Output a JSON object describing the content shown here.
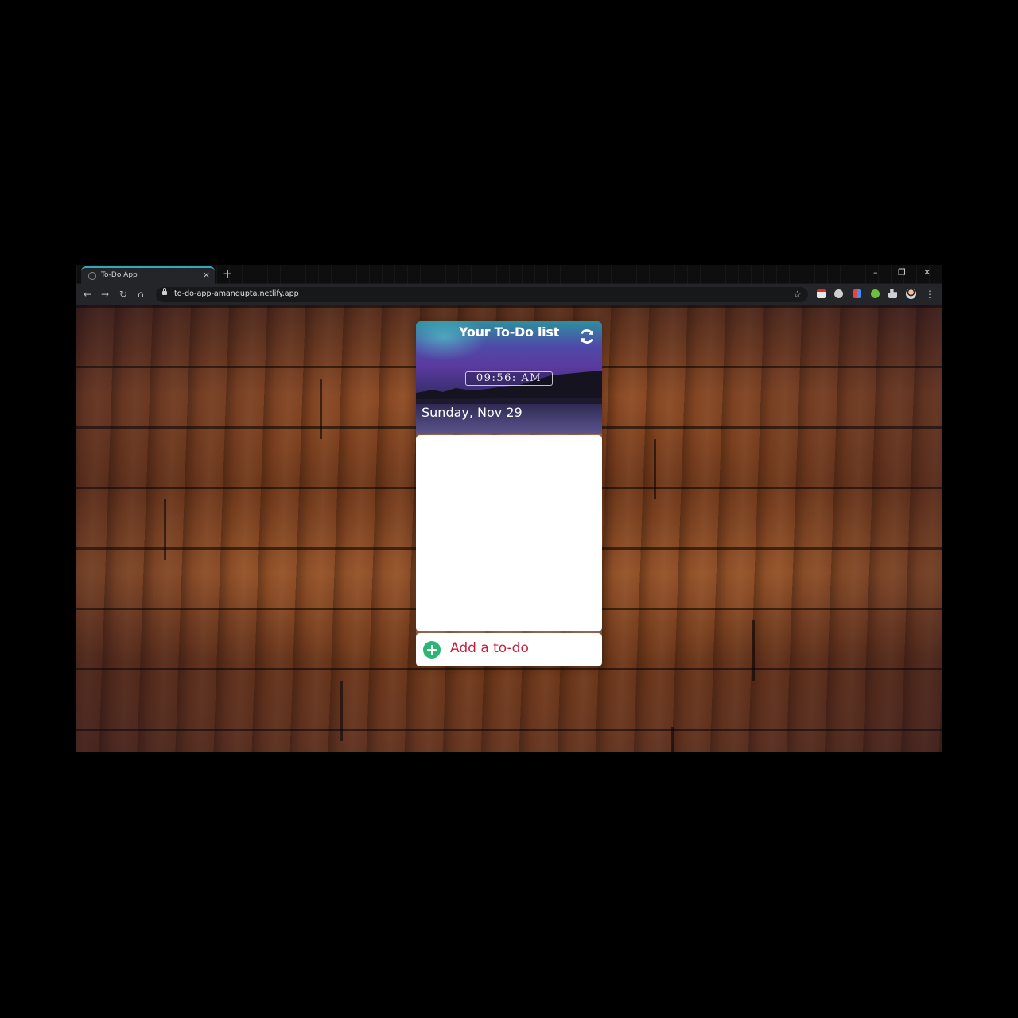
{
  "browser": {
    "tab_title": "To-Do App",
    "tab_close": "×",
    "new_tab": "+",
    "window_controls": {
      "minimize": "–",
      "restore": "❐",
      "close": "✕"
    },
    "nav": {
      "back": "←",
      "forward": "→",
      "reload": "↻",
      "home": "⌂"
    },
    "url": "to-do-app-amangupta.netlify.app",
    "bookmark_star": "☆",
    "menu": "⋮"
  },
  "todo": {
    "title": "Your To-Do list",
    "clock": "09:56: AM",
    "date": "Sunday, Nov 29",
    "add_label": "Add a to-do"
  },
  "colors": {
    "tab_accent": "#3aa6b9",
    "add_icon": "#2bb673",
    "add_label": "#c4203c"
  }
}
